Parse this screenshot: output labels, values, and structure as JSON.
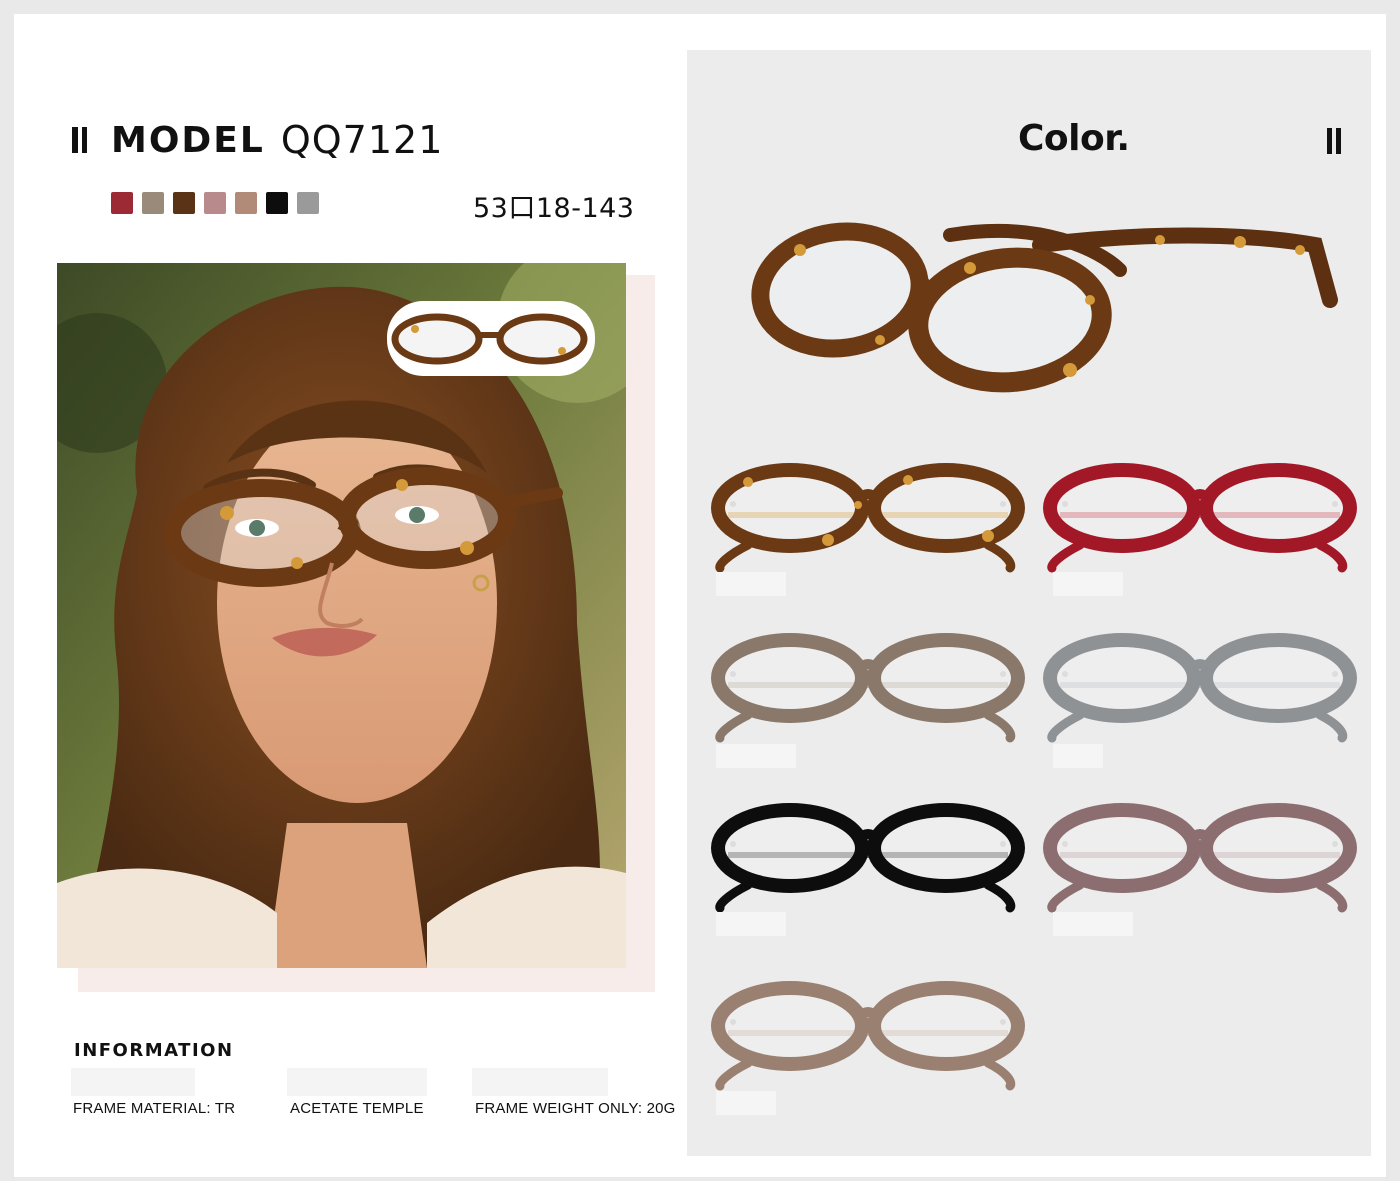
{
  "header": {
    "model_label": "MODEL",
    "model_code": "QQ7121",
    "size_text": "53口18-143"
  },
  "swatches": [
    {
      "name": "wine-red",
      "color": "#9b2a35"
    },
    {
      "name": "taupe",
      "color": "#9a8a7a"
    },
    {
      "name": "tortoise",
      "color": "#5a3215"
    },
    {
      "name": "dusty-pink",
      "color": "#b98a8c"
    },
    {
      "name": "brown-pink",
      "color": "#b28a78"
    },
    {
      "name": "black",
      "color": "#0d0d0d"
    },
    {
      "name": "grey",
      "color": "#9a9a9a"
    }
  ],
  "information": {
    "title": "INFORMATION",
    "items": [
      "FRAME MATERIAL: TR",
      "ACETATE TEMPLE",
      "FRAME WEIGHT ONLY: 20G"
    ]
  },
  "color_section": {
    "title": "Color."
  },
  "frames": [
    {
      "name": "tortoise",
      "frame": "#6b3a14",
      "accent": "#d49a3a",
      "tortoise": true
    },
    {
      "name": "wine-red",
      "frame": "#a31826",
      "accent": "#c94050",
      "tortoise": false
    },
    {
      "name": "translucent-brown",
      "frame": "#8a786a",
      "accent": "#b5a89c",
      "tortoise": false
    },
    {
      "name": "translucent-grey",
      "frame": "#8f9295",
      "accent": "#b9bcbf",
      "tortoise": false
    },
    {
      "name": "black",
      "frame": "#0d0d0d",
      "accent": "#3a3a3a",
      "tortoise": false
    },
    {
      "name": "translucent-mauve",
      "frame": "#8c6e70",
      "accent": "#b79a9c",
      "tortoise": false
    },
    {
      "name": "translucent-tan",
      "frame": "#9a8070",
      "accent": "#c6b0a0",
      "tortoise": false
    }
  ]
}
